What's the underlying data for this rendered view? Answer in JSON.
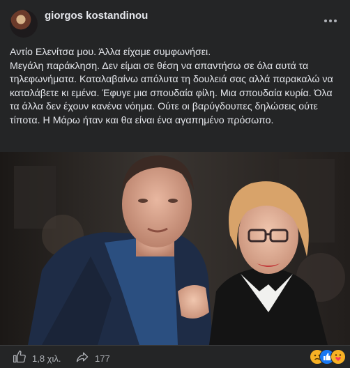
{
  "post": {
    "author": "giorgos kostandinou",
    "text_lines": [
      "Αντίο Ελενίτσα μου. Άλλα είχαμε συμφωνήσει.",
      "Μεγάλη παράκληση. Δεν είμαι σε θέση να απαντήσω σε όλα αυτά τα τηλεφωνήματα. Καταλαβαίνω απόλυτα τη δουλειά σας αλλά παρακαλώ να καταλάβετε κι εμένα. Έφυγε μια σπουδαία φίλη. Μια σπουδαία κυρία. Όλα τα άλλα δεν έχουν κανένα νόημα. Ούτε οι βαρύγδουπες δηλώσεις ούτε τίποτα. Η Μάρω ήταν και θα είναι ένα αγαπημένο πρόσωπο."
    ]
  },
  "footer": {
    "likes_count": "1,8 χιλ.",
    "shares_count": "177"
  },
  "icons": {
    "more": "more-options-icon",
    "like": "thumbs-up-icon",
    "share": "share-arrow-icon",
    "reactions": [
      "sad-reaction-icon",
      "like-reaction-icon",
      "care-reaction-icon"
    ]
  },
  "colors": {
    "background": "#242526",
    "text": "#e4e6eb",
    "secondary_text": "#b0b3b8",
    "like_blue": "#1877f2",
    "reaction_yellow": "#f7b125"
  }
}
